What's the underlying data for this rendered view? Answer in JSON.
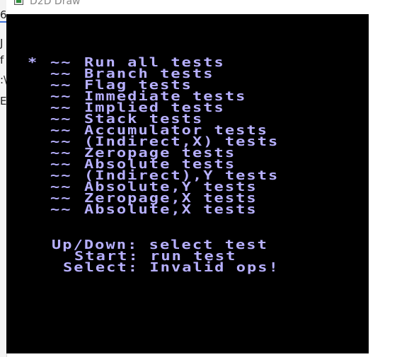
{
  "window": {
    "title": "D2D Draw",
    "icon": "app-window-icon"
  },
  "background_fragments": [
    "6",
    "J",
    "f",
    ":\\",
    "E"
  ],
  "menu": {
    "cursor": "*",
    "prefix": "~~",
    "selected_index": 0,
    "items": [
      "Run all tests",
      "Branch tests",
      "Flag tests",
      "Immediate tests",
      "Implied tests",
      "Stack tests",
      "Accumulator tests",
      "(Indirect,X) tests",
      "Zeropage tests",
      "Absolute tests",
      "(Indirect),Y tests",
      "Absolute,Y tests",
      "Zeropage,X tests",
      "Absolute,X tests"
    ]
  },
  "help": [
    "Up/Down: select test",
    "Start: run test",
    "Select: Invalid ops!"
  ],
  "colors": {
    "screen_background": "#000000",
    "text": "#b7b0ff"
  }
}
